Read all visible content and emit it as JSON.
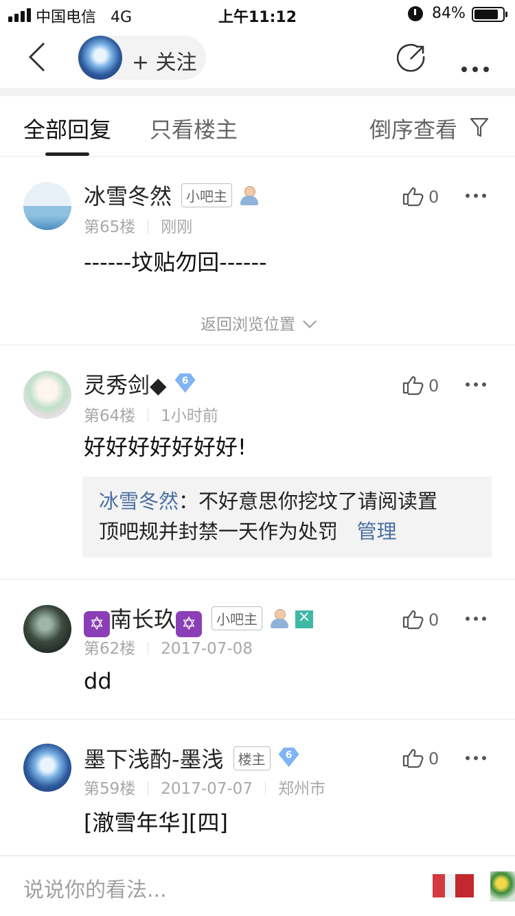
{
  "status_bar": {
    "carrier": "中国电信",
    "network": "4G",
    "time": "上午11:12",
    "battery": "84%",
    "battery_level": 0.84
  },
  "nav": {
    "follow_label": "+ 关注"
  },
  "tabs": {
    "all_replies": "全部回复",
    "owner_only": "只看楼主",
    "reverse": "倒序查看"
  },
  "posts": [
    {
      "username": "冰雪冬然",
      "tag": "小吧主",
      "floor": "第65楼",
      "time": "刚刚",
      "content": "------坟贴勿回------",
      "likes": "0",
      "return_label": "返回浏览位置"
    },
    {
      "username": "灵秀剑◆",
      "level": "6",
      "floor": "第64楼",
      "time": "1小时前",
      "content": "好好好好好好好!",
      "likes": "0",
      "reply_name": "冰雪冬然",
      "reply_colon": "：",
      "reply_text_1": "不好意思你挖坟了请阅读置",
      "reply_text_2": "顶吧规并封禁一天作为处罚",
      "reply_link": "管理"
    },
    {
      "star": "✡",
      "username": "南长玖",
      "tag": "小吧主",
      "floor": "第62楼",
      "time": "2017-07-08",
      "content": "dd",
      "likes": "0"
    },
    {
      "username": "墨下浅酌-墨浅",
      "tag": "楼主",
      "level": "6",
      "floor": "第59楼",
      "time": "2017-07-07",
      "location": "郑州市",
      "content": "[澈雪年华][四]",
      "likes": "0"
    }
  ],
  "input": {
    "placeholder": "说说你的看法..."
  }
}
